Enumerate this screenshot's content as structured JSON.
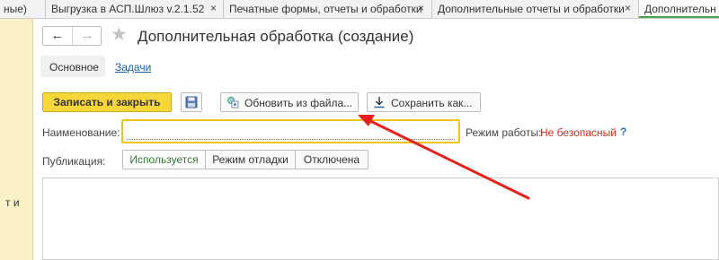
{
  "tabs": [
    {
      "label": "ные)",
      "active": false
    },
    {
      "label": "Выгрузка в АСП.Шлюз v.2.1.52",
      "active": false
    },
    {
      "label": "Печатные формы, отчеты и обработки",
      "active": false
    },
    {
      "label": "Дополнительные отчеты и обработки",
      "active": false
    },
    {
      "label": "Дополнительн",
      "active": true
    }
  ],
  "tab_close_glyph": "×",
  "left_panel": {
    "fragment": "т и"
  },
  "nav": {
    "back_glyph": "←",
    "forward_glyph": "→",
    "favorite_glyph": "★"
  },
  "page": {
    "title": "Дополнительная обработка (создание)"
  },
  "subtabs": {
    "main": "Основное",
    "tasks": "Задачи"
  },
  "toolbar": {
    "save_close": "Записать и закрыть",
    "save_icon": "floppy-disk-icon",
    "update_from_file": "Обновить из файла...",
    "save_as": "Сохранить как..."
  },
  "form": {
    "name_label": "Наименование:",
    "name_value": "",
    "mode_label": "Режим работы:",
    "mode_value": "Не безопасный",
    "help_glyph": "?",
    "publication_label": "Публикация:",
    "publication_options": [
      "Используется",
      "Режим отладки",
      "Отключена"
    ],
    "publication_selected": "Используется"
  },
  "colors": {
    "primary_button": "#f7d63a",
    "active_tab_underline": "#4aa64a",
    "mode_value": "#d62b1f",
    "link": "#1d5ea8",
    "selected_option": "#2e7d32",
    "field_highlight": "#f0c419",
    "annotation_arrow": "#e8201a"
  }
}
